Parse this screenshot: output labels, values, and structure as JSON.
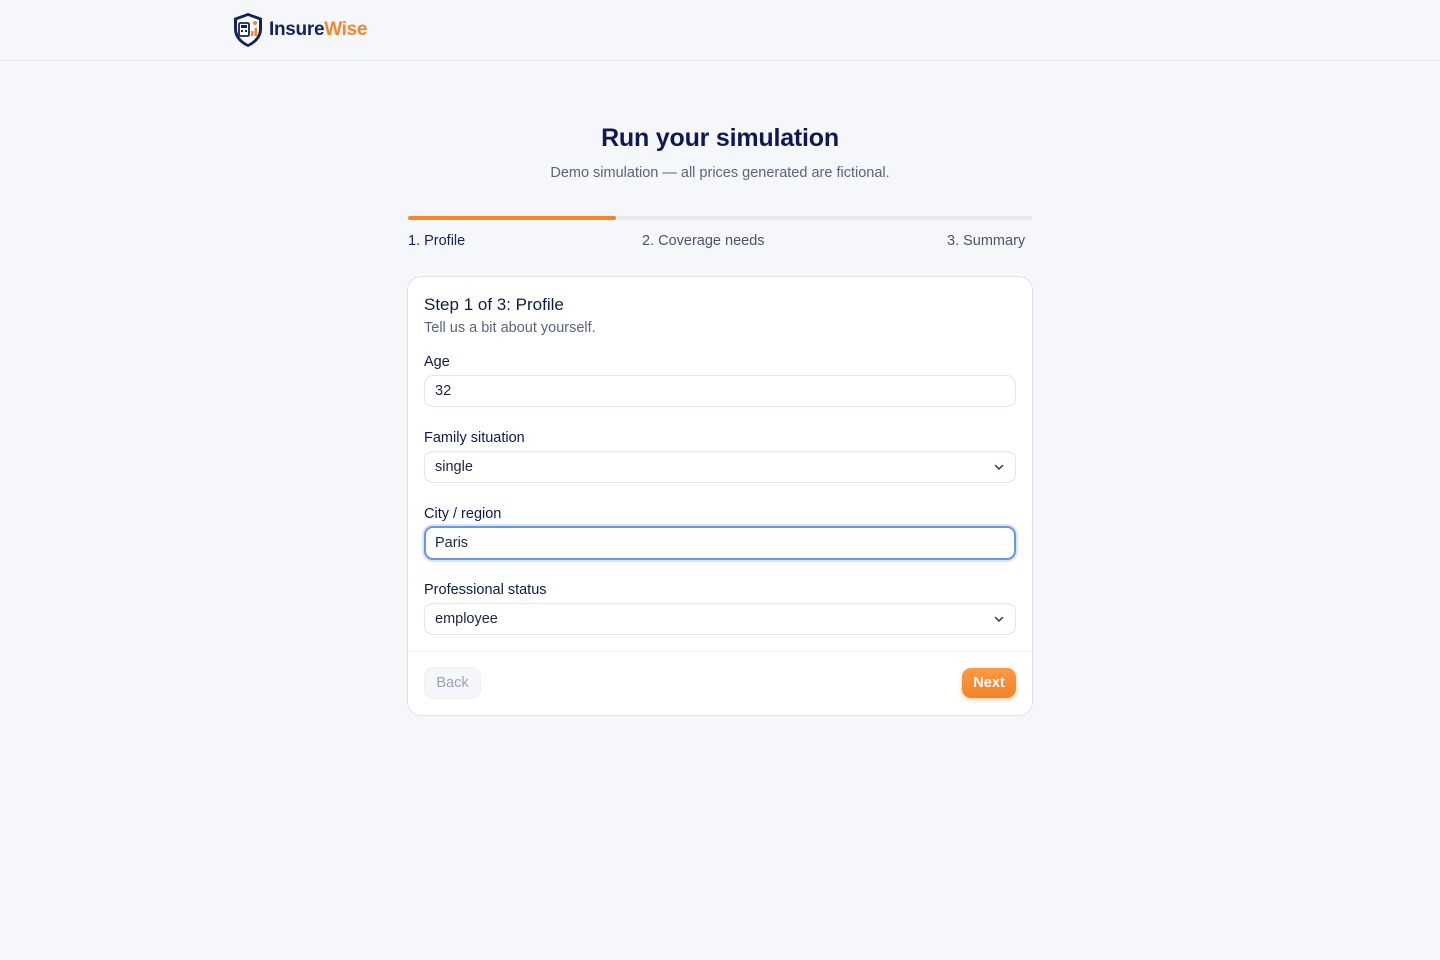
{
  "brand": {
    "name_part1": "Insure",
    "name_part2": "Wise",
    "primary_color": "#14235c",
    "accent_color": "#f0862e"
  },
  "page": {
    "title": "Run your simulation",
    "subtitle": "Demo simulation — all prices generated are fictional."
  },
  "progress": {
    "fraction": 0.333,
    "steps": [
      {
        "label": "1. Profile",
        "active": true
      },
      {
        "label": "2. Coverage needs",
        "active": false
      },
      {
        "label": "3. Summary",
        "active": false
      }
    ]
  },
  "form": {
    "title": "Step 1 of 3: Profile",
    "description": "Tell us a bit about yourself.",
    "fields": {
      "age": {
        "label": "Age",
        "value": "32"
      },
      "family": {
        "label": "Family situation",
        "value": "single"
      },
      "city": {
        "label": "City / region",
        "value": "Paris"
      },
      "status": {
        "label": "Professional status",
        "value": "employee"
      }
    },
    "back_label": "Back",
    "next_label": "Next"
  },
  "icons": {
    "logo": "shield-calculator-icon",
    "dropdown": "chevron-down-icon"
  }
}
